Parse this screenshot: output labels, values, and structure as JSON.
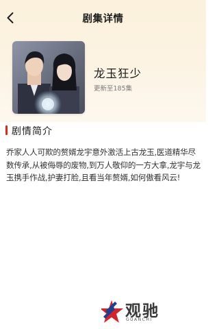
{
  "header": {
    "title": "剧集详情",
    "back_icon": "chevron-left-icon"
  },
  "series": {
    "title": "龙玉狂少",
    "update_status": "更新至185集"
  },
  "synopsis": {
    "heading": "剧情简介",
    "text": "乔家人人可欺的赘婿龙宇意外激活上古龙玉,医道精华尽数传承,从被侮辱的废物,到万人敬仰的一方大拿,龙宇与龙玉携手作战,护妻打脸,且看当年赘婿,如何傲看风云!"
  },
  "watermark": {
    "name": "观驰",
    "sub": "GUANCHI"
  },
  "colors": {
    "accent": "#e0261d",
    "hero_background": "#fbf1dc"
  }
}
